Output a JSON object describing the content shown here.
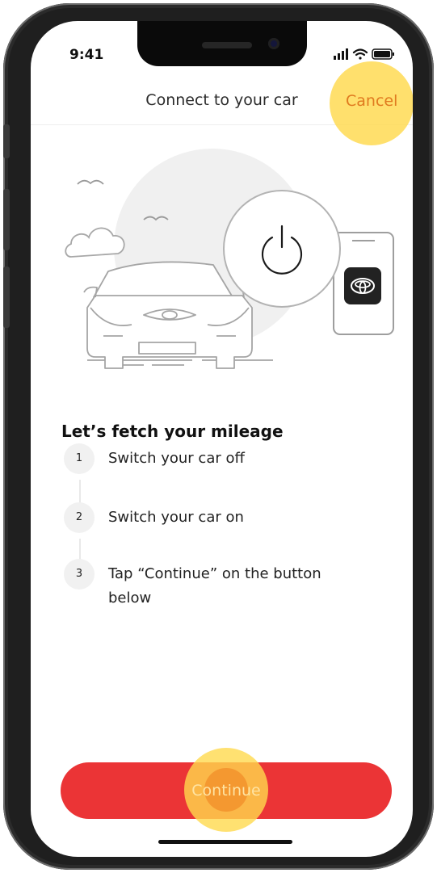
{
  "status_bar": {
    "time": "9:41"
  },
  "header": {
    "title": "Connect to your car",
    "cancel_label": "Cancel"
  },
  "content": {
    "heading": "Let’s fetch your mileage",
    "steps": [
      {
        "number": "1",
        "text": "Switch your car off"
      },
      {
        "number": "2",
        "text": "Switch your car on"
      },
      {
        "number": "3",
        "text": "Tap “Continue” on the button below"
      }
    ]
  },
  "footer": {
    "continue_label": "Continue"
  },
  "colors": {
    "primary_button": "#eb3436",
    "accent": "#e07a1f",
    "tap_highlight": "#ffd94d"
  },
  "icons": [
    "power-icon",
    "toyota-logo-icon",
    "car-illustration",
    "signal-icon",
    "wifi-icon",
    "battery-icon"
  ]
}
